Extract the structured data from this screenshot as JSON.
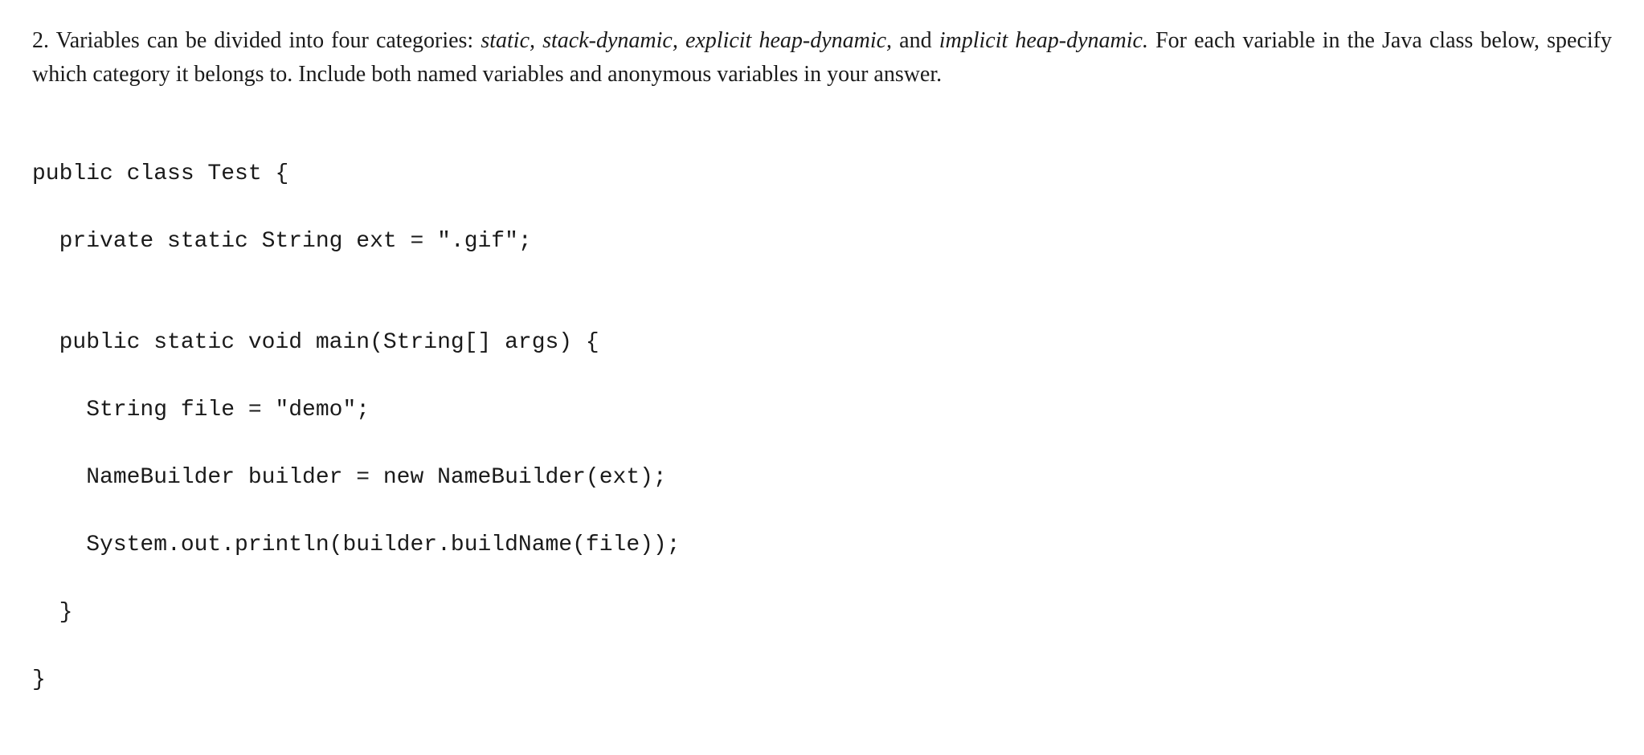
{
  "question": {
    "number": "2.",
    "text_part1": " Variables can be divided into four categories: ",
    "cat1": "static,",
    "cat2": " stack-dynamic,",
    "cat3": " explicit heap-dynamic,",
    "text_and": " and ",
    "cat4": "implicit heap-dynamic.",
    "text_part2": " For each variable in the Java class below, specify which category it belongs to. Include both named variables and anonymous variables in your answer."
  },
  "code": {
    "line1": "public class Test {",
    "line2": "  private static String ext = \".gif\";",
    "line3": "",
    "line4": "  public static void main(String[] args) {",
    "line5": "    String file = \"demo\";",
    "line6": "    NameBuilder builder = new NameBuilder(ext);",
    "line7": "    System.out.println(builder.buildName(file));",
    "line8": "  }",
    "line9": "}"
  }
}
